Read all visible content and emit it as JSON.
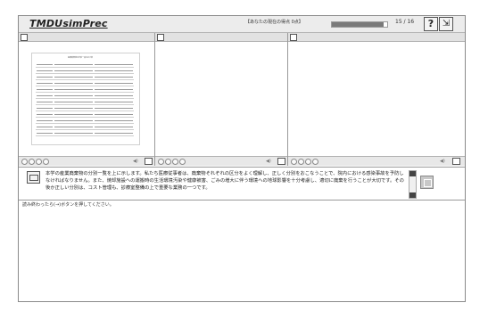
{
  "header": {
    "logo_text": "TMDUsimPrec",
    "score_label": "【あなたの現在の得点 0点】",
    "progress": {
      "current": 15,
      "total": 16,
      "text": "15 / 16",
      "fraction": 0.9375
    },
    "help_label": "?",
    "exit_label": "⇲"
  },
  "panels": [
    {
      "name": "panel-1",
      "has_document": true
    },
    {
      "name": "panel-2",
      "has_document": false
    },
    {
      "name": "panel-3",
      "has_document": false
    }
  ],
  "document": {
    "title": "医療廃棄物の分別一覧を示す表"
  },
  "media": {
    "volume_label": "◀)"
  },
  "narration": {
    "text": "本学の産業廃棄物の分別一覧を上に示します。私たち医療従事者は、廃棄物それぞれの区分をよく理解し、正しく分別をおこなうことで、院内における感染事故を予防しなければなりません。また、焼却施設への運搬時の生活環境汚染や健康被害、ごみの増大に伴う環境への地球影響を十分考慮し、適切に廃棄を行うことが大切です。その後か正しい分別は、コスト管理も、診療室整備の上で重要な業務の一つです。"
  },
  "instruction": "読み終わったら(→)ボタンを押してください。"
}
